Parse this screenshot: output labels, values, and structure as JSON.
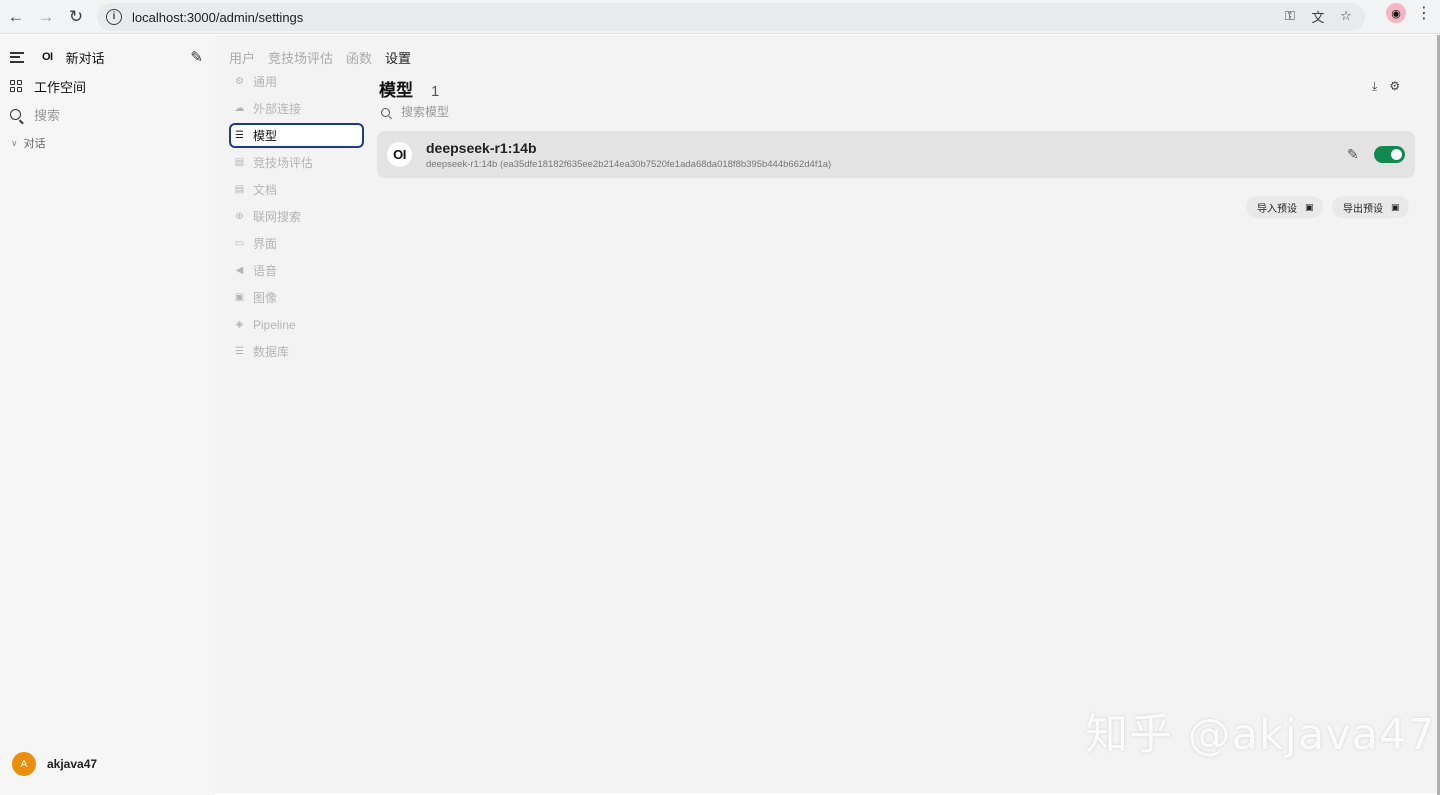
{
  "browser": {
    "url": "localhost:3000/admin/settings"
  },
  "sidebar": {
    "logo": "OI",
    "new_chat": "新对话",
    "workspace": "工作空间",
    "search": "搜索",
    "conversations": "对话",
    "user": {
      "initial": "A",
      "name": "akjava47"
    }
  },
  "top_nav": [
    "用户",
    "竞技场评估",
    "函数",
    "设置"
  ],
  "settings_nav": [
    {
      "label": "通用",
      "icon": "gear-icon"
    },
    {
      "label": "外部连接",
      "icon": "cloud-icon"
    },
    {
      "label": "模型",
      "icon": "database-icon",
      "active": true
    },
    {
      "label": "竞技场评估",
      "icon": "document-icon"
    },
    {
      "label": "文档",
      "icon": "document-icon"
    },
    {
      "label": "联网搜索",
      "icon": "globe-icon"
    },
    {
      "label": "界面",
      "icon": "monitor-icon"
    },
    {
      "label": "语音",
      "icon": "speaker-icon"
    },
    {
      "label": "图像",
      "icon": "image-icon"
    },
    {
      "label": "Pipeline",
      "icon": "layers-icon"
    },
    {
      "label": "数据库",
      "icon": "database-icon"
    }
  ],
  "models": {
    "title": "模型",
    "count": "1",
    "search_placeholder": "搜索模型",
    "items": [
      {
        "logo": "OI",
        "name": "deepseek-r1:14b",
        "detail": "deepseek-r1:14b (ea35dfe18182f635ee2b214ea30b7520fe1ada68da018f8b395b444b662d4f1a)",
        "enabled": true
      }
    ],
    "import_preset": "导入预设",
    "export_preset": "导出预设"
  },
  "watermark": "知乎 @akjava47",
  "colors": {
    "accent_toggle": "#0f8a4f",
    "active_border": "#1e3a8a",
    "avatar": "#ea8f0c"
  }
}
